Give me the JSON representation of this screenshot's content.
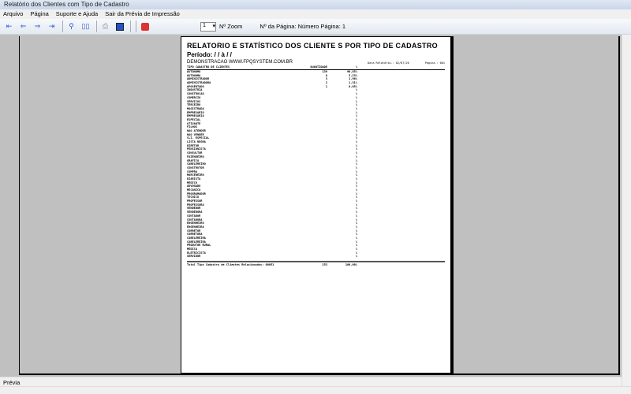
{
  "window": {
    "title": "Relatório dos Clientes com Tipo de Cadastro"
  },
  "menu": [
    "Arquivo",
    "Página",
    "Suporte e Ajuda",
    "Sair da Prévia de Impressão"
  ],
  "toolbar": {
    "zoom_value": "1",
    "zoom_label": "Nº Zoom",
    "page_label": "Nº da Página: Número Página: 1"
  },
  "status": "Prévia",
  "report": {
    "title": "RELATORIO E STATÍSTICO DOS CLIENTE S POR TIPO DE CADASTRO",
    "period": "Período:  / /  à  / /",
    "company": "DEMONSTRACAO WWW.FPQSYSTEM.COM.BR",
    "date": "Data Relatório.: 02/07/26",
    "page": "Pagina.: 001",
    "headers": [
      "TIPO CADASTRO DE CLIENTES",
      "QUANTIDADE",
      "%"
    ],
    "rows": [
      [
        "AUTONOMO",
        "139",
        "90,85%"
      ],
      [
        "AUTONOMA",
        "8",
        "5,23%"
      ],
      [
        "ADMINISTRADOR",
        "3",
        "1,96%"
      ],
      [
        "ADMINISTRADORA",
        "2",
        "1,31%"
      ],
      [
        "APOSENTADO",
        "1",
        "0,65%"
      ],
      [
        "INDUSTRIA",
        "",
        "%"
      ],
      [
        "CONSTRUCAO",
        "",
        "%"
      ],
      [
        "COMERCIO",
        "",
        "%"
      ],
      [
        "SERVICOS",
        "",
        "%"
      ],
      [
        "TERCEIRO",
        "",
        "%"
      ],
      [
        "MAGISTRADA",
        "",
        "%"
      ],
      [
        "EMPRESARIO",
        "",
        "%"
      ],
      [
        "EMPRESARIA",
        "",
        "%"
      ],
      [
        "ESPECIAL",
        "",
        "%"
      ],
      [
        "ATIVANTE",
        "",
        "%"
      ],
      [
        "FILHOS",
        "",
        "%"
      ],
      [
        "NAO ATENDER",
        "",
        "%"
      ],
      [
        "NAO VENDER",
        "",
        "%"
      ],
      [
        "CLI. ESPECIAL",
        "",
        "%"
      ],
      [
        "LISTA NEGRA",
        "",
        "%"
      ],
      [
        "DIRETOR",
        "",
        "%"
      ],
      [
        "PENSIONISTA",
        "",
        "%"
      ],
      [
        "CONSULTOR",
        "",
        "%"
      ],
      [
        "FAZENDEIRO",
        "",
        "%"
      ],
      [
        "GRAFICO",
        "",
        "%"
      ],
      [
        "CABELEREIRO",
        "",
        "%"
      ],
      [
        "CONSTRUTOR",
        "",
        "%"
      ],
      [
        "COMPRA",
        "",
        "%"
      ],
      [
        "MARCENEIRO",
        "",
        "%"
      ],
      [
        "DIARISTA",
        "",
        "%"
      ],
      [
        "MEDICO",
        "",
        "%"
      ],
      [
        "ADVOGADO",
        "",
        "%"
      ],
      [
        "MECANICO",
        "",
        "%"
      ],
      [
        "PROGRAMADOR",
        "",
        "%"
      ],
      [
        "TECNICO",
        "",
        "%"
      ],
      [
        "PROFESSOR",
        "",
        "%"
      ],
      [
        "PROFESSORA",
        "",
        "%"
      ],
      [
        "VENDEDOR",
        "",
        "%"
      ],
      [
        "VENDEDORA",
        "",
        "%"
      ],
      [
        "CONTADOR",
        "",
        "%"
      ],
      [
        "CONTADORA",
        "",
        "%"
      ],
      [
        "ENGENHEIRO",
        "",
        "%"
      ],
      [
        "ENGENHEIRA",
        "",
        "%"
      ],
      [
        "CORRETOR",
        "",
        "%"
      ],
      [
        "CORRETORA",
        "",
        "%"
      ],
      [
        "CABELEREIRA",
        "",
        "%"
      ],
      [
        "CABELEREIRA",
        "",
        "%"
      ],
      [
        "PRODUTOR RURAL",
        "",
        "%"
      ],
      [
        "MEDICA",
        "",
        "%"
      ],
      [
        "ELETRICISTA",
        "",
        "%"
      ],
      [
        "SERVIDOR",
        "",
        "%"
      ]
    ],
    "total": [
      "Total Tipo Cadastro de Clientes Relacionados: 00051",
      "153",
      "100,00%"
    ]
  }
}
